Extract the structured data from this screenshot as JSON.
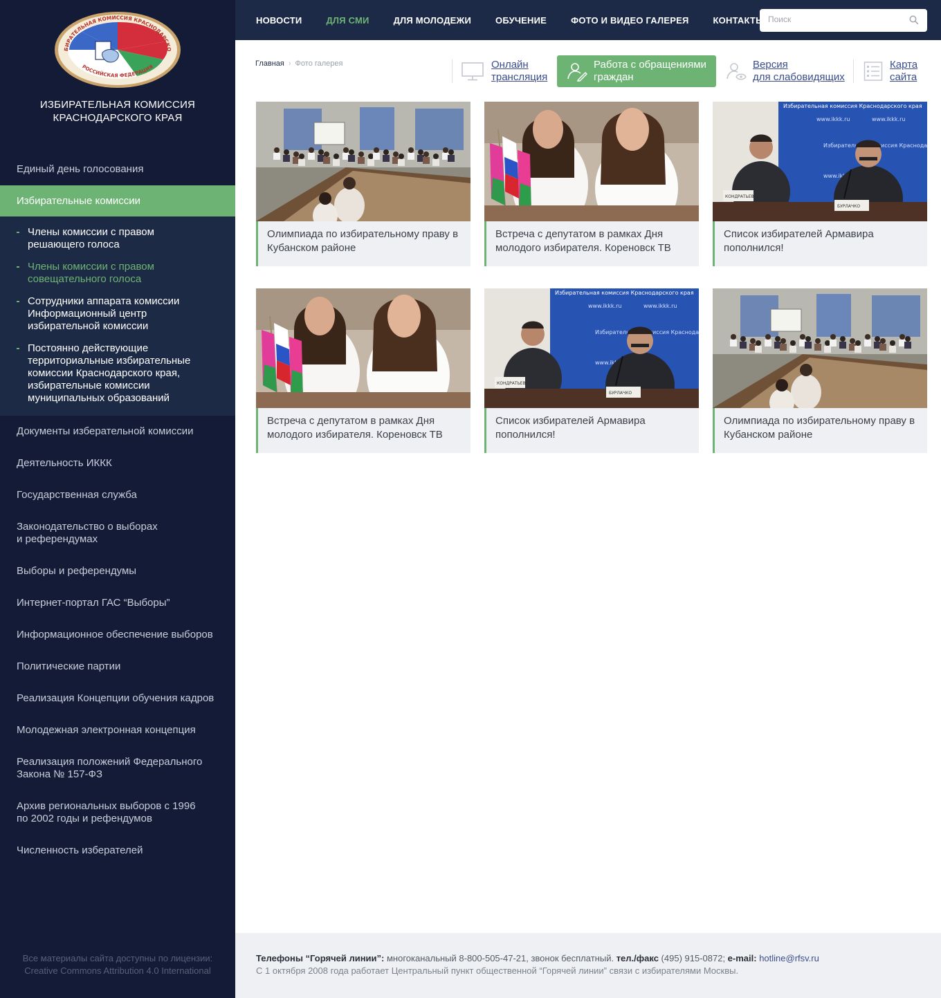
{
  "sidebar": {
    "org_name_line1": "ИЗБИРАТЕЛЬНАЯ КОМИССИЯ",
    "org_name_line2": "КРАСНОДАРСКОГО КРАЯ",
    "logo_text_top": "ИЗБИРАТЕЛЬНАЯ КОМИССИЯ КРАСНОДАРСКОГО",
    "logo_text_bottom": "РОССИЙСКАЯ ФЕДЕРАЦИЯ",
    "menu_before": [
      "Единый день голосования"
    ],
    "active_item": "Избирательные комиссии",
    "submenu": [
      {
        "lines": [
          "Члены комиссии с правом",
          "решающего голоса"
        ],
        "current": false
      },
      {
        "lines": [
          "Члены комиссии с правом",
          "совещательного голоса"
        ],
        "current": true
      },
      {
        "lines": [
          "Сотрудники аппарата комиссии",
          "Информационный центр",
          "избирательной комиссии"
        ],
        "current": false
      },
      {
        "lines": [
          "Постоянно действующие",
          "территориальные избирательные",
          "комиссии Краснодарского края,",
          "избирательные комиссии",
          "муниципальных образований"
        ],
        "current": false
      }
    ],
    "menu_after": [
      [
        "Документы изберательной комиссии"
      ],
      [
        "Деятельность ИККК"
      ],
      [
        "Государственная служба"
      ],
      [
        "Законодательство о выборах",
        "и референдумах"
      ],
      [
        "Выборы и референдумы"
      ],
      [
        "Интернет-портал ГАС “Выборы”"
      ],
      [
        "Информационное обеспечение выборов"
      ],
      [
        "Политические партии"
      ],
      [
        "Реализация Концепции обучения кадров"
      ],
      [
        "Молодежная электронная концепция"
      ],
      [
        "Реализация положений Федерального",
        "Закона № 157-ФЗ"
      ],
      [
        "Архив региональных выборов с 1996",
        "по 2002 годы и рефендумов"
      ],
      [
        "Численность изберателей"
      ]
    ],
    "license_line1": "Все материалы сайта доступны по лицензии:",
    "license_line2": "Creative Commons Attribution 4.0 International"
  },
  "nav": {
    "items": [
      "НОВОСТИ",
      "ДЛЯ СМИ",
      "ДЛЯ МОЛОДЕЖИ",
      "ОБУЧЕНИЕ",
      "ФОТО И ВИДЕО ГАЛЕРЕЯ",
      "КОНТАКТЫ"
    ],
    "active_index": 1,
    "search_placeholder": "Поиск"
  },
  "breadcrumb": {
    "home": "Главная",
    "separator": "›",
    "current": "Фото галерея"
  },
  "tools": {
    "online": [
      "Онлайн",
      "трансляция"
    ],
    "appeal": [
      "Работа с обращениями",
      "граждан"
    ],
    "vision": [
      "Версия",
      "для слабовидящих"
    ],
    "sitemap": [
      "Карта",
      "сайта"
    ]
  },
  "gallery": [
    {
      "caption": "Олимпиада по избирательному праву в Кубанском районе",
      "scene": "hall"
    },
    {
      "caption": "Встреча с депутатом в рамках Дня молодого избирателя. Кореновск ТВ",
      "scene": "girls"
    },
    {
      "caption": "Список избирателей Армавира пополнился!",
      "scene": "press"
    },
    {
      "caption": "Встреча с депутатом в рамках Дня молодого избирателя. Кореновск ТВ",
      "scene": "girls"
    },
    {
      "caption": "Список избирателей Армавира пополнился!",
      "scene": "press"
    },
    {
      "caption": "Олимпиада по избирательному праву в Кубанском районе",
      "scene": "hall"
    }
  ],
  "photo_text": {
    "banner_title": "Избирательная комиссия Краснодарского края",
    "banner_url": "www.ikkk.ru",
    "nameplate_left": "КОНДРАТЬЕВ",
    "nameplate_right": "БУРЛАЧКО"
  },
  "footer": {
    "hotline_label": "Телефоны “Горячей линии”:",
    "hotline_text": " многоканальный 8-800-505-47-21, звонок бесплатный. ",
    "fax_label": "тел./факс",
    "fax_text": " (495) 915-0872; ",
    "email_label": "e-mail:",
    "email": "hotline@rfsv.ru",
    "line2": "С 1 октября 2008 года работает Центральный пункт общественной “Горячей линии” связи с избирателями Москвы."
  },
  "colors": {
    "sidebar_bg": "#141b36",
    "topbar_bg": "#1c2a48",
    "accent_green": "#6db474",
    "link_blue": "#3a4d8b"
  }
}
